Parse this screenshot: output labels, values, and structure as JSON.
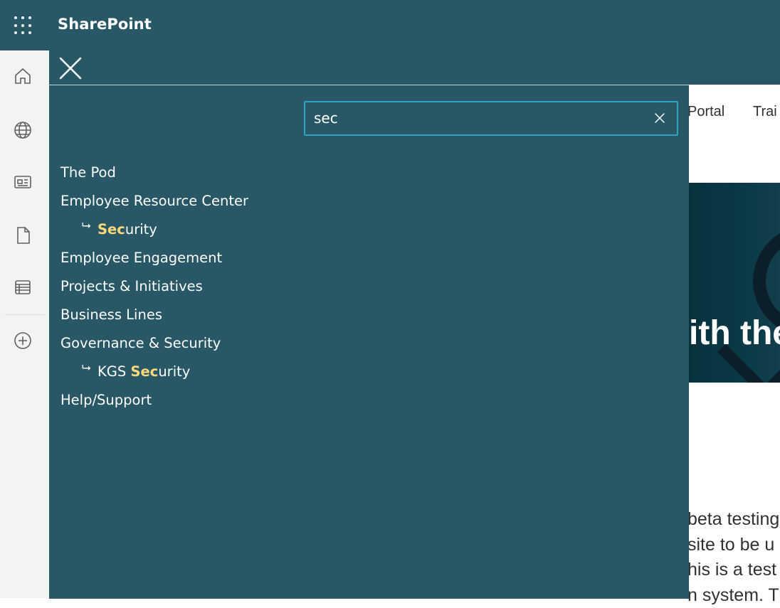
{
  "suite": {
    "brand": "SharePoint"
  },
  "background_page": {
    "nav": [
      "Portal",
      "Trai"
    ],
    "hero_text": "ith the",
    "body_lines": [
      "beta testing",
      "site to be u",
      "his is a test",
      "n system. Th"
    ]
  },
  "search": {
    "value": "sec",
    "placeholder": ""
  },
  "nav_results": [
    {
      "label": "The Pod"
    },
    {
      "label": "Employee Resource Center"
    },
    {
      "prefix": "",
      "match": "Sec",
      "rest": "urity",
      "arrow": "⮡"
    },
    {
      "label": "Employee Engagement"
    },
    {
      "label": "Projects & Initiatives"
    },
    {
      "label": "Business Lines"
    },
    {
      "label": "Governance & Security"
    },
    {
      "prefix": "KGS ",
      "match": "Sec",
      "rest": "urity",
      "arrow": "⮡"
    },
    {
      "label": "Help/Support"
    }
  ],
  "colors": {
    "panel": "#285766",
    "highlight": "#ffd87a",
    "search_border": "#2ea3c5"
  }
}
